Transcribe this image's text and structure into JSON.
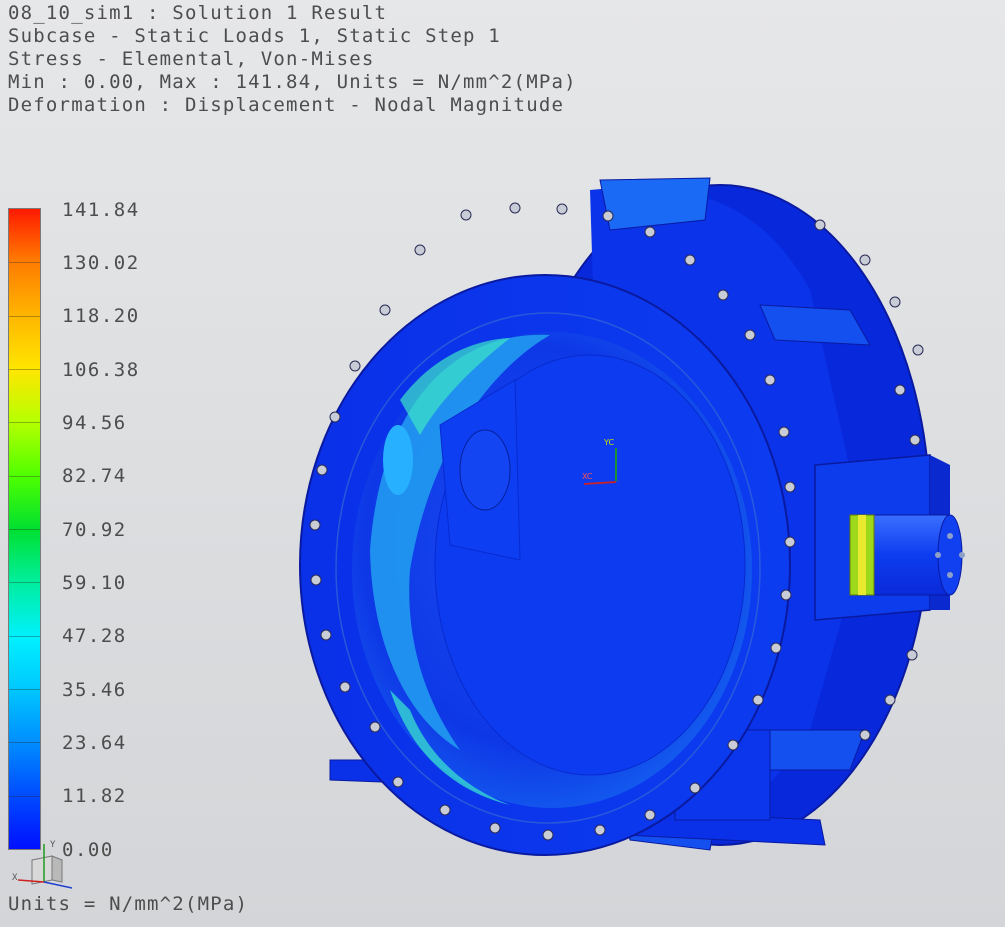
{
  "header": {
    "line1": "08_10_sim1 : Solution 1 Result",
    "line2": "Subcase - Static Loads 1, Static Step 1",
    "line3": "Stress - Elemental, Von-Mises",
    "line4": "Min : 0.00, Max : 141.84, Units = N/mm^2(MPa)",
    "line5": "Deformation : Displacement - Nodal Magnitude"
  },
  "legend": {
    "labels": [
      "141.84",
      "130.02",
      "118.20",
      "106.38",
      "94.56",
      "82.74",
      "70.92",
      "59.10",
      "47.28",
      "35.46",
      "23.64",
      "11.82",
      "0.00"
    ],
    "min_color": "#0010ff",
    "max_color": "#ff1a00"
  },
  "footer": {
    "units": "Units = N/mm^2(MPa)"
  },
  "triad": {
    "x_label": "X",
    "y_label": "Y"
  },
  "wcs": {
    "x_label": "XC",
    "y_label": "YC"
  }
}
